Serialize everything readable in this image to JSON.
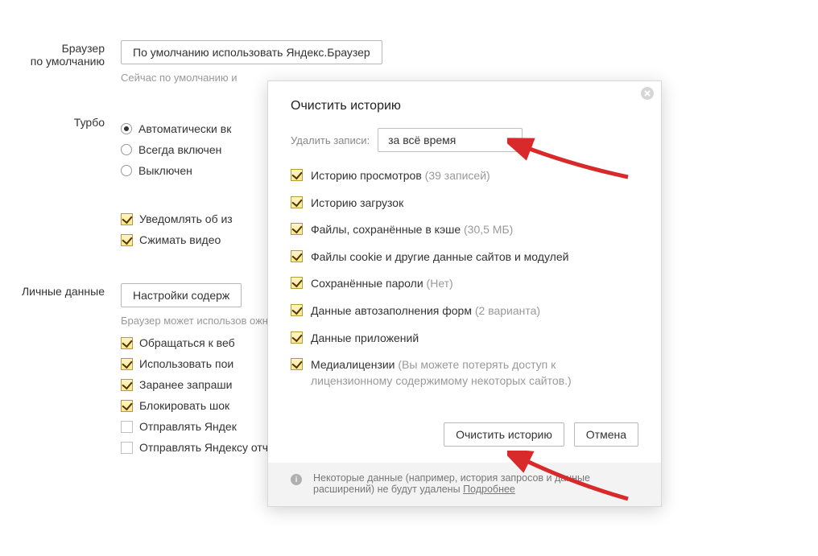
{
  "sections": {
    "default_browser": {
      "label": "Браузер\nпо умолчанию",
      "button": "По умолчанию использовать Яндекс.Браузер",
      "hint": "Сейчас по умолчанию и"
    },
    "turbo": {
      "label": "Турбо",
      "radios": [
        {
          "text": "Автоматически вк",
          "checked": true
        },
        {
          "text": "Всегда включен",
          "checked": false
        },
        {
          "text": "Выключен",
          "checked": false
        }
      ],
      "checks": [
        {
          "text": "Уведомлять об из",
          "checked": true
        },
        {
          "text": "Сжимать видео",
          "checked": true
        }
      ]
    },
    "personal": {
      "label": "Личные данные",
      "button": "Настройки содерж",
      "hint": "Браузер может использов                                                                                                                            ожности вам не нужны, их можно отк",
      "checks": [
        {
          "text": "Обращаться к веб",
          "checked": true,
          "empty": false
        },
        {
          "text": "Использовать пои",
          "checked": true,
          "empty": false
        },
        {
          "text": "Заранее запраши",
          "checked": true,
          "empty": false
        },
        {
          "text": "Блокировать шок",
          "checked": true,
          "empty": false
        },
        {
          "text": "Отправлять Яндек",
          "checked": false,
          "empty": true
        },
        {
          "text": "Отправлять Яндексу отчеты о сбоях",
          "checked": false,
          "empty": true
        }
      ]
    }
  },
  "dialog": {
    "title": "Очистить историю",
    "delete_label": "Удалить записи:",
    "select_value": "за всё время",
    "options": [
      {
        "text": "Историю просмотров ",
        "muted": "(39 записей)",
        "checked": true
      },
      {
        "text": "Историю загрузок",
        "muted": "",
        "checked": true
      },
      {
        "text": "Файлы, сохранённые в кэше ",
        "muted": "(30,5 МБ)",
        "checked": true
      },
      {
        "text": "Файлы cookie и другие данные сайтов и модулей",
        "muted": "",
        "checked": true
      },
      {
        "text": "Сохранённые пароли ",
        "muted": "(Нет)",
        "checked": true
      },
      {
        "text": "Данные автозаполнения форм ",
        "muted": "(2 варианта)",
        "checked": true
      },
      {
        "text": "Данные приложений",
        "muted": "",
        "checked": true
      },
      {
        "text": "Медиалицензии ",
        "muted": "(Вы можете потерять доступ к лицензионному содержимому некоторых сайтов.)",
        "checked": true
      }
    ],
    "actions": {
      "clear": "Очистить историю",
      "cancel": "Отмена"
    },
    "footer": {
      "text": "Некоторые данные (например, история запросов и данные расширений) не будут удалены ",
      "link": "Подробнее"
    }
  }
}
